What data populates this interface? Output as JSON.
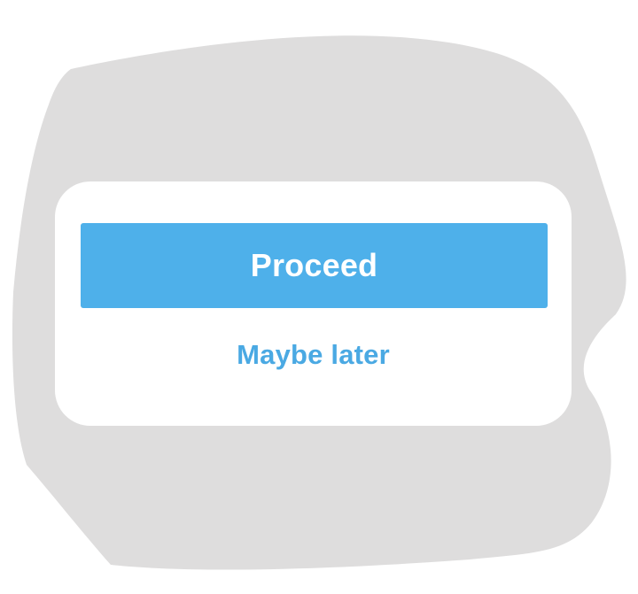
{
  "dialog": {
    "primary_label": "Proceed",
    "secondary_label": "Maybe later"
  },
  "colors": {
    "primary": "#4eb0ea",
    "link": "#4aa9e3",
    "backdrop": "#dedddd",
    "card": "#ffffff"
  }
}
